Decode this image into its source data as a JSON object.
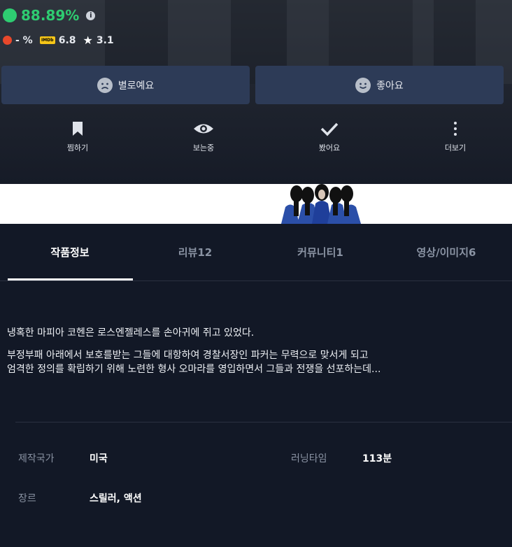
{
  "scores": {
    "audience_score": "88.89%",
    "info_icon": "info-icon",
    "tomato_score": "- %",
    "imdb_badge": "IMDb",
    "imdb_score": "6.8",
    "star_score": "3.1"
  },
  "vote_buttons": {
    "bad_label": "별로예요",
    "good_label": "좋아요"
  },
  "actions": {
    "wishlist": "찜하기",
    "watching": "보는중",
    "watched": "봤어요",
    "more": "더보기"
  },
  "tabs": [
    {
      "label": "작품정보",
      "active": true
    },
    {
      "label": "리뷰12",
      "active": false
    },
    {
      "label": "커뮤니티1",
      "active": false
    },
    {
      "label": "영상/이미지6",
      "active": false
    }
  ],
  "synopsis": {
    "line1": "냉혹한 마피아 코헨은 로스엔젤레스를 손아귀에 쥐고 있었다.",
    "line2": "부정부패 아래에서 보호를받는 그들에 대항하여 경찰서장인 파커는 무력으로 맞서게 되고",
    "line3": "엄격한 정의를 확립하기 위해 노련한 형사 오마라를 영입하면서 그들과 전쟁을 선포하는데..."
  },
  "meta": {
    "country_label": "제작국가",
    "country_value": "미국",
    "runtime_label": "러닝타임",
    "runtime_value": "113분",
    "genre_label": "장르",
    "genre_value": "스릴러, 액션"
  },
  "colors": {
    "background": "#121826",
    "button": "#2d3b57",
    "accent_green": "#2ecc71",
    "tomato": "#e8482b",
    "imdb": "#f5c518"
  }
}
